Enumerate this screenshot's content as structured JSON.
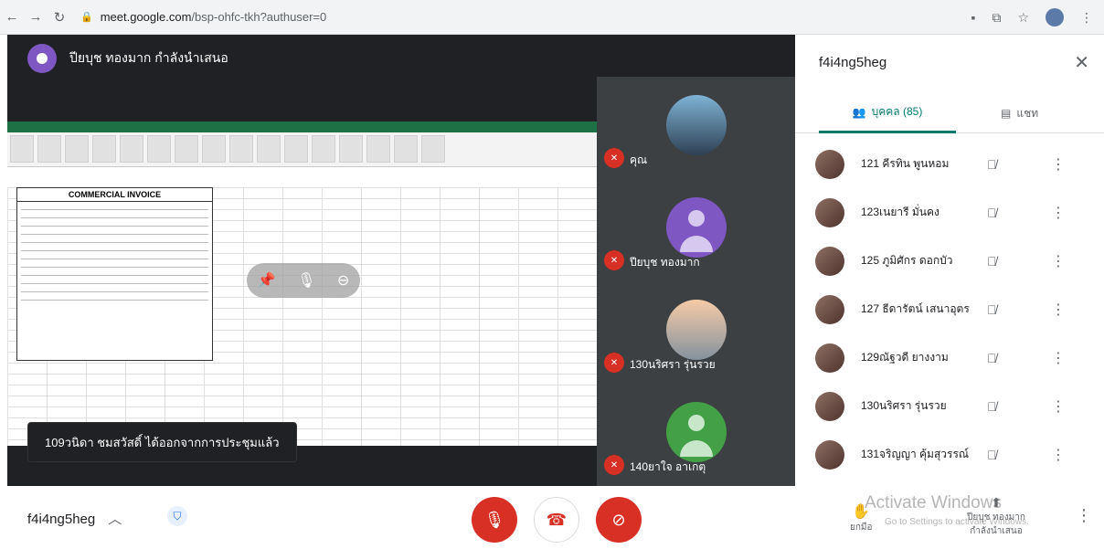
{
  "browser": {
    "url_host": "meet.google.com",
    "url_path": "/bsp-ohfc-tkh?authuser=0"
  },
  "stage": {
    "presenter_text": "ปียบุช ทองมาก กำลังนำเสนอ",
    "sheet_title": "COMMERCIAL INVOICE",
    "toast": "109วนิดา ชมสวัสดิ์ ได้ออกจากการประชุมแล้ว"
  },
  "tiles": [
    {
      "label": "คุณ"
    },
    {
      "label": "ปียบุช ทองมาก"
    },
    {
      "label": "130นริศรา รุ่นรวย"
    },
    {
      "label": "140ยาใจ อาเกตุ"
    }
  ],
  "panel": {
    "title": "f4i4ng5heg",
    "tab_people": "บุคคล (85)",
    "tab_chat": "แชท",
    "participants": [
      {
        "name": "121 คีรทิน พูนหอม"
      },
      {
        "name": "123เนยารี มั่นคง"
      },
      {
        "name": "125 ภูมิศักร ดอกบัว"
      },
      {
        "name": "127 ธีดารัตน์ เสนาอุตร"
      },
      {
        "name": "129ณัฐวดี ยางงาม"
      },
      {
        "name": "130นริศรา รุ่นรวย"
      },
      {
        "name": "131จริญญา คุ้มสุวรรณ์"
      }
    ]
  },
  "bottom": {
    "meeting_code": "f4i4ng5heg",
    "raise_label": "ยกมือ",
    "present_label_1": "ปียบุช ทองมาก",
    "present_label_2": "กำลังนำเสนอ",
    "watermark_1": "Activate Windows",
    "watermark_2": "Go to Settings to activate Windows."
  }
}
